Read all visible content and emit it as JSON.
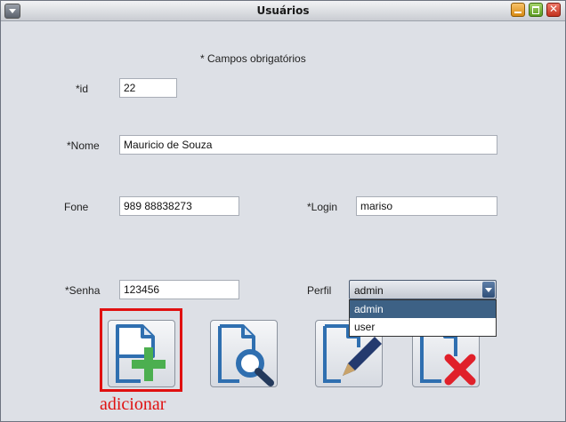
{
  "window": {
    "title": "Usuários"
  },
  "form": {
    "required_note": "* Campos obrigatórios",
    "id": {
      "label": "*id",
      "value": "22"
    },
    "nome": {
      "label": "*Nome",
      "value": "Mauricio de Souza"
    },
    "fone": {
      "label": "Fone",
      "value": "989 88838273"
    },
    "login": {
      "label": "*Login",
      "value": "mariso"
    },
    "senha": {
      "label": "*Senha",
      "value": "123456"
    },
    "perfil": {
      "label": "Perfil",
      "selected": "admin",
      "options": [
        "admin",
        "user"
      ]
    }
  },
  "toolbar": {
    "buttons": [
      {
        "name": "adicionar",
        "icon": "document-add-icon"
      },
      {
        "name": "pesquisar",
        "icon": "document-search-icon"
      },
      {
        "name": "editar",
        "icon": "document-edit-icon"
      },
      {
        "name": "remover",
        "icon": "document-delete-icon"
      }
    ]
  },
  "annotation": {
    "caption": "adicionar",
    "color": "#e01010"
  }
}
